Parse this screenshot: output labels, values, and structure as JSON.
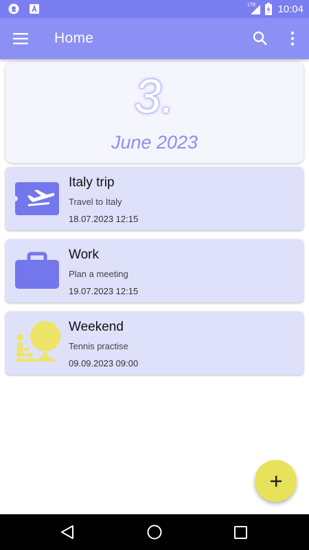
{
  "status_bar": {
    "time": "10:04",
    "network": "LTE",
    "icons": [
      "notification-icon",
      "text-app-icon",
      "signal-icon",
      "battery-charging-icon"
    ]
  },
  "app_bar": {
    "title": "Home",
    "icons": [
      "menu-icon",
      "search-icon",
      "more-vert-icon"
    ]
  },
  "date_card": {
    "day": "3.",
    "month_year": "June 2023"
  },
  "events": [
    {
      "icon": "airplane-ticket-icon",
      "title": "Italy trip",
      "description": "Travel to Italy",
      "datetime": "18.07.2023 12:15"
    },
    {
      "icon": "briefcase-icon",
      "title": "Work",
      "description": "Plan a meeting",
      "datetime": "19.07.2023 12:15"
    },
    {
      "icon": "park-bench-icon",
      "title": "Weekend",
      "description": "Tennis practise",
      "datetime": "09.09.2023 09:00"
    }
  ],
  "fab": {
    "icon": "plus-icon"
  },
  "nav_bar": {
    "icons": [
      "back-icon",
      "home-circle-icon",
      "recents-icon"
    ]
  },
  "colors": {
    "status_bar": "#7b7ef0",
    "app_bar": "#8c8ff4",
    "card_bg": "#dfe0fa",
    "date_card_bg": "#f5f5fd",
    "accent_icon": "#7476ec",
    "weekend_icon": "#ece56a",
    "fab": "#e8e15a"
  }
}
